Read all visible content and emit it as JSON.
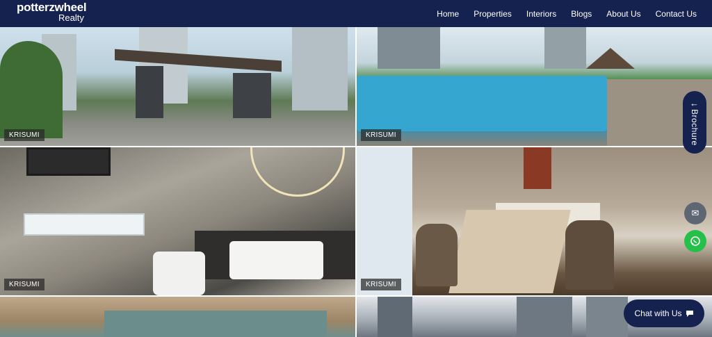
{
  "brand": {
    "logo_top": "potterzwheel",
    "logo_bottom": "Realty"
  },
  "nav": {
    "items": [
      {
        "label": "Home"
      },
      {
        "label": "Properties"
      },
      {
        "label": "Interiors"
      },
      {
        "label": "Blogs"
      },
      {
        "label": "About Us"
      },
      {
        "label": "Contact Us"
      }
    ]
  },
  "gallery": {
    "tiles": [
      {
        "tag": "KRISUMI",
        "subject": "entrance-gate-photo"
      },
      {
        "tag": "KRISUMI",
        "subject": "swimming-pool-photo"
      },
      {
        "tag": "KRISUMI",
        "subject": "bathroom-photo"
      },
      {
        "tag": "KRISUMI",
        "subject": "dining-room-photo"
      },
      {
        "tag": "",
        "subject": "interior-photo"
      },
      {
        "tag": "",
        "subject": "tower-exterior-photo"
      }
    ]
  },
  "widgets": {
    "brochure_label": "Brochure",
    "brochure_icon": "arrow-left-icon",
    "email_icon": "email-icon",
    "whatsapp_icon": "whatsapp-icon",
    "chat_label": "Chat with Us",
    "chat_icon": "chat-bubble-icon"
  },
  "colors": {
    "navy": "#15214f",
    "whatsapp": "#25c04a",
    "email": "#5e6674"
  }
}
